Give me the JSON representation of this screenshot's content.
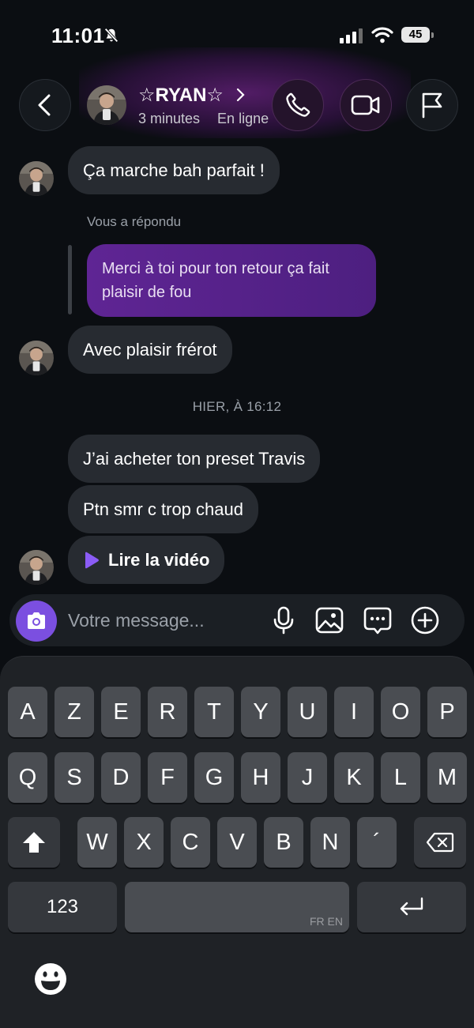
{
  "status_bar": {
    "time": "11:01",
    "battery": "45"
  },
  "header": {
    "name": "☆RYAN☆",
    "status_time": "3 minutes",
    "status_presence": "En ligne"
  },
  "messages": [
    {
      "text": "Ça marche bah parfait !"
    },
    {
      "reply_note": "Vous a répondu",
      "text": "Merci à toi pour ton retour ça fait plaisir de fou"
    },
    {
      "text": "Avec plaisir frérot"
    },
    {
      "day_separator": "HIER, À 16:12"
    },
    {
      "text": "J’ai acheter ton preset Travis"
    },
    {
      "text": "Ptn smr c trop chaud"
    },
    {
      "text": "Lire la vidéo"
    }
  ],
  "composer": {
    "placeholder": "Votre message..."
  },
  "keyboard": {
    "row1": [
      "A",
      "Z",
      "E",
      "R",
      "T",
      "Y",
      "U",
      "I",
      "O",
      "P"
    ],
    "row2": [
      "Q",
      "S",
      "D",
      "F",
      "G",
      "H",
      "J",
      "K",
      "L",
      "M"
    ],
    "row3": [
      "W",
      "X",
      "C",
      "V",
      "B",
      "N",
      "´"
    ],
    "numbers_label": "123",
    "space_lang": "FR EN"
  },
  "colors": {
    "accent": "#7b4fe0",
    "my_bubble": "#5a2390",
    "their_bubble": "#272b31",
    "background": "#0b0e12"
  }
}
